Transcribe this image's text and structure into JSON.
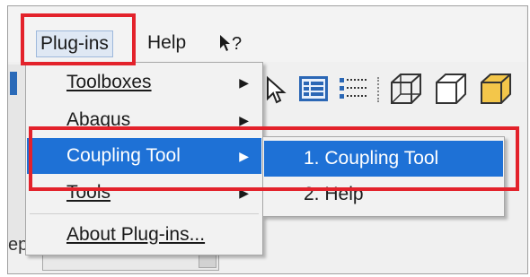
{
  "menubar": {
    "items": [
      {
        "label": "Plug-ins"
      },
      {
        "label": "Help"
      }
    ],
    "whats_this": "?"
  },
  "plugins_menu": {
    "items": [
      {
        "label": "Toolboxes",
        "has_submenu": true
      },
      {
        "label": "Abaqus",
        "has_submenu": true
      },
      {
        "label": "Coupling Tool",
        "has_submenu": true,
        "highlighted": true
      },
      {
        "label": "Tools",
        "has_submenu": true
      },
      {
        "label": "About Plug-ins...",
        "has_submenu": false
      }
    ],
    "arrow_glyph": "▶"
  },
  "coupling_submenu": {
    "items": [
      {
        "label": "1. Coupling Tool",
        "highlighted": true
      },
      {
        "label": "2. Help"
      }
    ]
  },
  "status": {
    "label_fragment": "ep"
  },
  "colors": {
    "highlight": "#1e71d6",
    "annotation_red": "#e3222b",
    "menu_bg": "#f2f2f2"
  },
  "toolbar_icons": [
    "select-cursor-icon",
    "list-view-icon",
    "tree-view-icon",
    "wireframe-cube-icon",
    "hidden-line-cube-icon",
    "shaded-cube-icon"
  ]
}
